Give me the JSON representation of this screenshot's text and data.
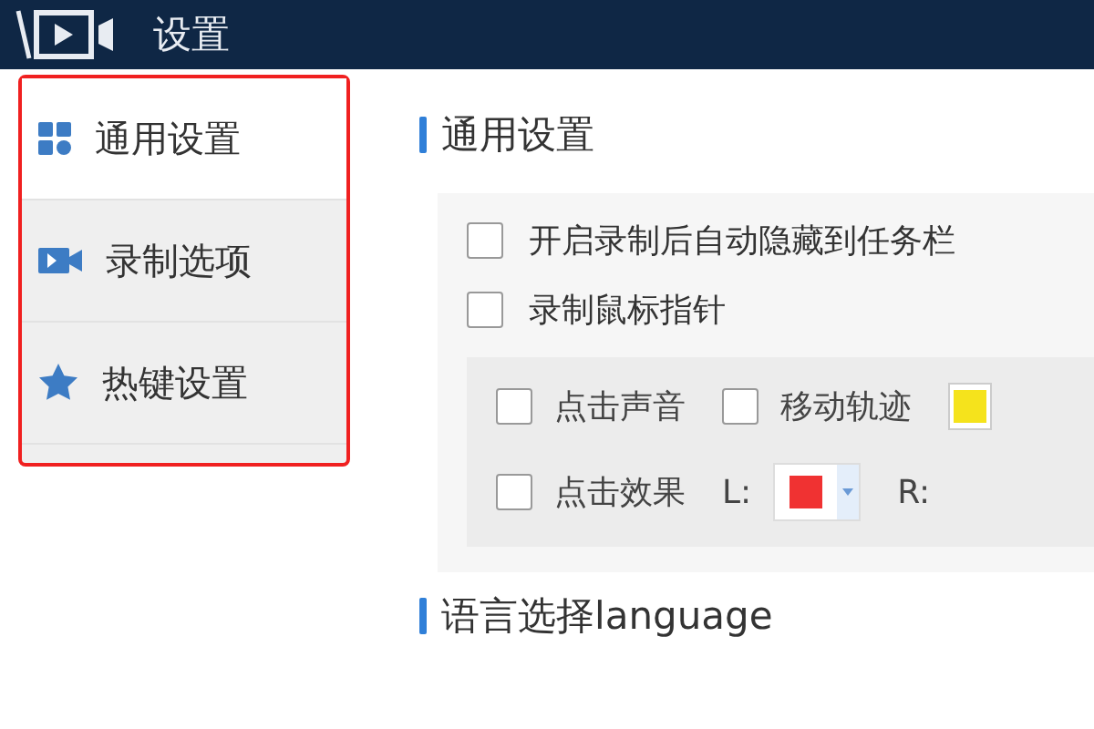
{
  "window": {
    "title": "设置"
  },
  "sidebar": {
    "items": [
      {
        "label": "通用设置",
        "kind": "grid",
        "selected": true
      },
      {
        "label": "录制选项",
        "kind": "camera",
        "selected": false
      },
      {
        "label": "热键设置",
        "kind": "star",
        "selected": false
      }
    ]
  },
  "sections": [
    {
      "title": "通用设置"
    },
    {
      "title": "语言选择language"
    }
  ],
  "options": [
    {
      "label": "开启录制后自动隐藏到任务栏",
      "checked": false
    },
    {
      "label": "录制鼠标指针",
      "checked": false
    }
  ],
  "pointer_options": [
    [
      {
        "kind": "checkbox",
        "label": "点击声音",
        "checked": false
      },
      {
        "kind": "checkbox",
        "label": "移动轨迹",
        "checked": false
      },
      {
        "kind": "swatch",
        "color": "#f5e31c"
      }
    ],
    [
      {
        "kind": "checkbox",
        "label": "点击效果",
        "checked": false
      },
      {
        "kind": "picker",
        "label": "L:",
        "color": "#f03232"
      },
      {
        "kind": "label",
        "label": "R:"
      }
    ]
  ]
}
